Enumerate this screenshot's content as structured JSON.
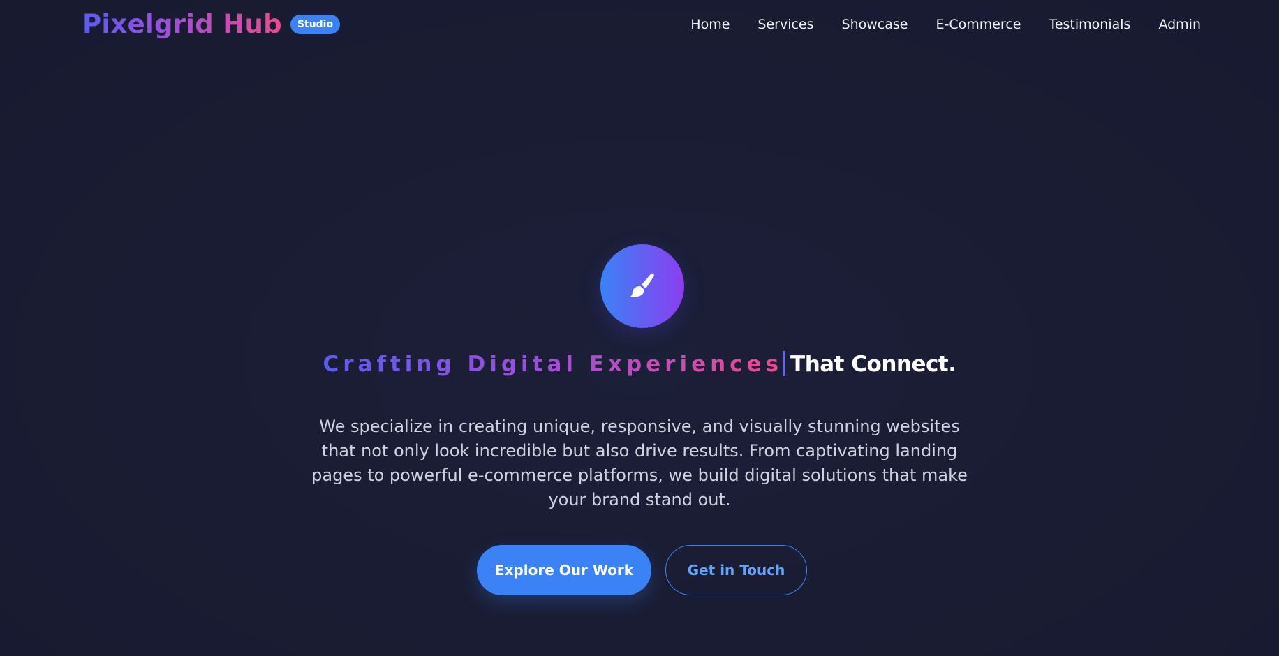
{
  "header": {
    "brand_name": "Pixelgrid Hub",
    "brand_badge": "Studio",
    "nav": [
      {
        "label": "Home"
      },
      {
        "label": "Services"
      },
      {
        "label": "Showcase"
      },
      {
        "label": "E-Commerce"
      },
      {
        "label": "Testimonials"
      },
      {
        "label": "Admin"
      }
    ]
  },
  "hero": {
    "icon": "paintbrush-icon",
    "headline_typed": "Crafting Digital Experiences",
    "headline_static": "That Connect.",
    "description": "We specialize in creating unique, responsive, and visually stunning websites that not only look incredible but also drive results. From captivating landing pages to powerful e-commerce platforms, we build digital solutions that make your brand stand out.",
    "primary_cta": "Explore Our Work",
    "secondary_cta": "Get in Touch"
  },
  "colors": {
    "background": "#1a1c33",
    "accent": "#3b82f6",
    "gradient_start": "#5b5cf0",
    "gradient_end": "#e84c8e"
  }
}
